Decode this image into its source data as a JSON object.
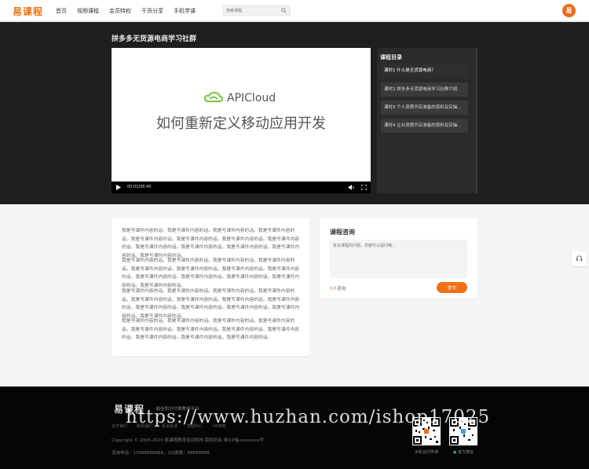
{
  "header": {
    "logo": "易课程",
    "nav": [
      "首页",
      "视频课程",
      "会员特权",
      "干货分享",
      "手机学课"
    ],
    "search_placeholder": "搜索课程",
    "avatar_text": "易"
  },
  "course": {
    "title": "拼多多无货源电商学习社群",
    "player": {
      "brand": "APICloud",
      "slogan": "如何重新定义移动应用开发",
      "time": "00:01/06:40"
    },
    "catalog_title": "课程目录",
    "lessons": [
      "课时1  什么是无货源电商？",
      "课时2  拼多多无货源电商学习社群介绍",
      "课时3  个人资质开店准备的资料及实操...",
      "课时4  企业资质开店准备的资料及实操..."
    ]
  },
  "description": {
    "paragraphs": [
      "我是写课件内容的话。我是写课件内容的话。我是写课件内容的话。我是写课件内容的话。我是写课件内容的话。我是写课件内容的话。我是写课件内容的话。我是写课件内容的话。我是写课件内容的话。我是写课件内容的话。我是写课件内容的话。我是写课件内容的话。我是写课件内容的话。",
      "我是写课件内容的话。我是写课件内容的话。我是写课件内容的话。我是写课件内容的话。我是写课件内容的话。我是写课件内容的话。我是写课件内容的话。我是写课件内容的话。我是写课件内容的话。我是写课件内容的话。我是写课件内容的话。我是写课件内容的话。我是写课件内容的话。",
      "我是写课件内容的话。我是写课件内容的话。我是写课件内容的话。我是写课件内容的话。我是写课件内容的话。我是写课件内容的话。我是写课件内容的话。我是写课件内容的话。我是写课件内容的话。我是写课件内容的话。我是写课件内容的话。我是写课件内容的话。我是写课件内容的话。",
      "我是写课件内容的话。我是写课件内容的话。我是写课件内容的话。我是写课件内容的话。我是写课件内容的话。我是写课件内容的话。我是写课件内容的话。我是写课件内容的话。我是写课件内容的话。我是写课件内容的话。我是写课件内容的话。"
    ]
  },
  "consult": {
    "title": "课程咨询",
    "placeholder": "有关课程的问题，您都可以提问哦...",
    "count": "0",
    "count_suffix": "人咨询",
    "submit": "提交"
  },
  "footer": {
    "logo": "易课程",
    "slogan": "· 最佳知识付费教学平台",
    "links": [
      "关于我们",
      "联系我们",
      "投诉反馈",
      "帮助中心",
      "VIP特权"
    ],
    "copyright": "Copyright © 2005-2020 易课程教育培训机构 版权所有 粤ICP备xxxxxxxx号",
    "contact": "咨询电话：13988888888，QQ客服：88888888",
    "qr_labels": [
      "手机访问学课",
      "官方微信"
    ],
    "watermark": "https://www.huzhan.com/ishop17025"
  },
  "colors": {
    "accent": "#f07014",
    "dark": "#1f1e20",
    "footer": "#050505"
  }
}
